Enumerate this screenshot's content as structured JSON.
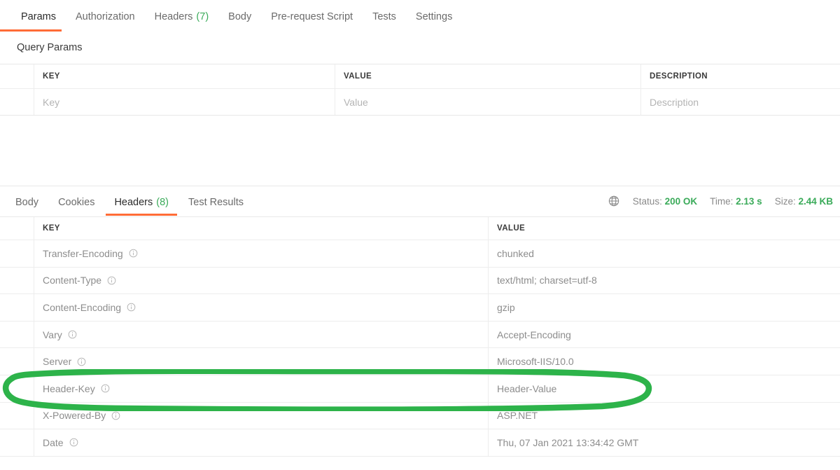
{
  "request": {
    "tabs": [
      {
        "label": "Params",
        "count": null,
        "active": true
      },
      {
        "label": "Authorization",
        "count": null,
        "active": false
      },
      {
        "label": "Headers",
        "count": "(7)",
        "active": false
      },
      {
        "label": "Body",
        "count": null,
        "active": false
      },
      {
        "label": "Pre-request Script",
        "count": null,
        "active": false
      },
      {
        "label": "Tests",
        "count": null,
        "active": false
      },
      {
        "label": "Settings",
        "count": null,
        "active": false
      }
    ],
    "section_title": "Query Params",
    "table": {
      "headers": {
        "key": "KEY",
        "value": "VALUE",
        "description": "DESCRIPTION"
      },
      "rows": [
        {
          "key": "Key",
          "value": "Value",
          "description": "Description"
        }
      ]
    }
  },
  "response": {
    "tabs": [
      {
        "label": "Body",
        "count": null,
        "active": false
      },
      {
        "label": "Cookies",
        "count": null,
        "active": false
      },
      {
        "label": "Headers",
        "count": "(8)",
        "active": true
      },
      {
        "label": "Test Results",
        "count": null,
        "active": false
      }
    ],
    "meta": {
      "globe_icon": "globe-icon",
      "status_label": "Status:",
      "status_value": "200 OK",
      "time_label": "Time:",
      "time_value": "2.13 s",
      "size_label": "Size:",
      "size_value": "2.44 KB"
    },
    "table": {
      "headers": {
        "key": "KEY",
        "value": "VALUE"
      },
      "rows": [
        {
          "key": "Transfer-Encoding",
          "value": "chunked",
          "highlighted": false
        },
        {
          "key": "Content-Type",
          "value": "text/html; charset=utf-8",
          "highlighted": false
        },
        {
          "key": "Content-Encoding",
          "value": "gzip",
          "highlighted": false
        },
        {
          "key": "Vary",
          "value": "Accept-Encoding",
          "highlighted": false
        },
        {
          "key": "Server",
          "value": "Microsoft-IIS/10.0",
          "highlighted": false
        },
        {
          "key": "Header-Key",
          "value": "Header-Value",
          "highlighted": true
        },
        {
          "key": "X-Powered-By",
          "value": "ASP.NET",
          "highlighted": false
        },
        {
          "key": "Date",
          "value": "Thu, 07 Jan 2021 13:34:42 GMT",
          "highlighted": false
        }
      ]
    }
  },
  "annotation": {
    "shape": "hand-drawn-ellipse",
    "color": "#2db34a",
    "targets_row_key": "Header-Key"
  },
  "colors": {
    "accent_orange": "#ff6c37",
    "success_green": "#3bab5a",
    "annotation_green": "#2db34a",
    "text": "#2b2b2b",
    "muted_text": "#8d8d8d",
    "placeholder": "#b4b4b4",
    "border": "#ededed",
    "background": "#ffffff"
  }
}
